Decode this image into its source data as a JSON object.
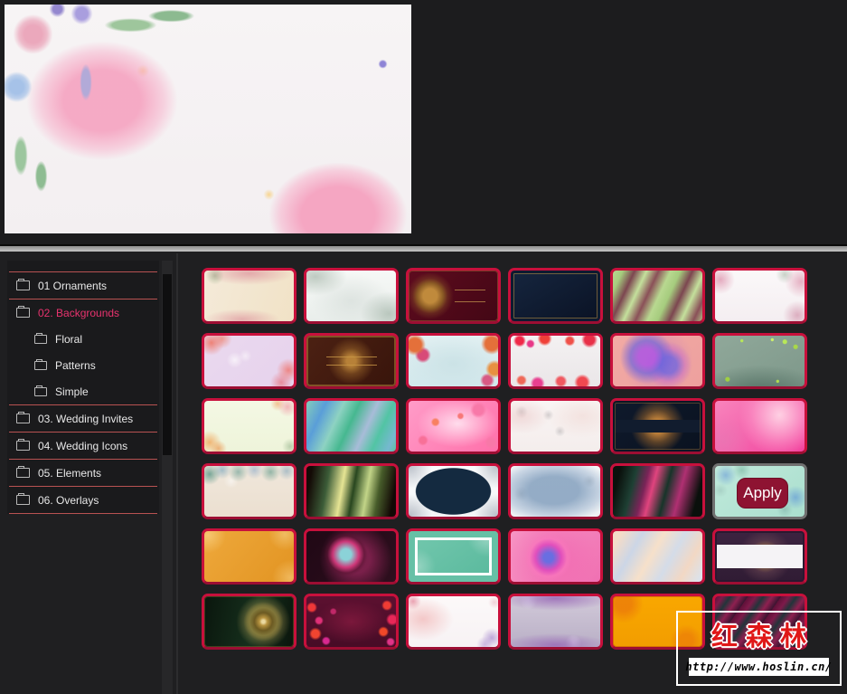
{
  "preview": {
    "name": "watercolor-floral-background",
    "style": "background: radial-gradient(circle 5px at 93% 26%, #8e84d6 60%, rgba(142,132,214,.5) 80%, transparent 100%), radial-gradient(circle 22px at 7% 13%, #eba8bc 45%, rgba(235,168,188,.75) 70%, transparent 100%), radial-gradient(circle 8px at 7% 13%, #c86a80 60%, transparent 100%), radial-gradient(circle 17px at 3% 36%, #a6c2e8 45%, rgba(166,194,232,.7) 75%, transparent 100%), radial-gradient(circle 5px at 3% 36%, #4a4a58 70%, transparent 100%), radial-gradient(circle 12px at 19% 4%, #a99ede 55%, transparent 100%), radial-gradient(circle 9px at 13% 2%, #9487cf 55%, transparent 100%), radial-gradient(ellipse 34px 9px at 31% 9%, #9ec69c 60%, transparent 85%), radial-gradient(ellipse 30px 8px at 41% 5%, #8cba90 60%, transparent 85%), radial-gradient(ellipse 9px 26px at 4% 66%, #9cc69e 60%, transparent 85%), radial-gradient(ellipse 8px 20px at 9% 75%, #8ebc92 60%, transparent 85%), radial-gradient(ellipse 8px 24px at 20% 34%, #b2aad8 60%, transparent 85%), radial-gradient(ellipse 95px 75px at 24% 42%, rgba(245,158,189,.85) 45%, rgba(247,176,202,.5) 72%, transparent 88%), radial-gradient(ellipse 85px 65px at 82% 92%, rgba(245,158,189,.9) 48%, rgba(247,176,202,.55) 75%, transparent 90%), radial-gradient(circle 7px at 34% 29%, rgba(249,206,120,.75), transparent 100%), radial-gradient(circle 6px at 65% 83%, rgba(249,206,120,.8), transparent 100%), linear-gradient(#f7f4f5,#f3eff1)"
  },
  "sidebar": {
    "items": [
      {
        "label": "01 Ornaments",
        "level": 0,
        "selected": false
      },
      {
        "label": "02. Backgrounds",
        "level": 0,
        "selected": true
      },
      {
        "label": "Floral",
        "level": 1,
        "selected": false
      },
      {
        "label": "Patterns",
        "level": 1,
        "selected": false
      },
      {
        "label": "Simple",
        "level": 1,
        "selected": false
      },
      {
        "label": "03. Wedding Invites",
        "level": 0,
        "selected": false
      },
      {
        "label": "04. Wedding Icons",
        "level": 0,
        "selected": false
      },
      {
        "label": "05. Elements",
        "level": 0,
        "selected": false
      },
      {
        "label": "06. Overlays",
        "level": 0,
        "selected": false
      }
    ],
    "selected_color": "#e8336e",
    "separator_color": "#b85252"
  },
  "apply_button": {
    "label": "Apply",
    "bg": "#8e1332",
    "text_color": "#ffffff"
  },
  "watermark": {
    "title": "红森林",
    "url": "http://www.hoslin.cn/",
    "title_color": "#e01818"
  },
  "colors": {
    "thumb_border": "#c8103c",
    "hovered_thumb_border": "#707070",
    "splitter": "#b5b5b5",
    "panel_bg": "#1a1a1c",
    "page_bg": "#1d1d1f"
  },
  "grid": {
    "columns": 6,
    "rows": 6,
    "thumbs": [
      {
        "name": "floral-cream-roses",
        "style": "background: radial-gradient(ellipse 70px 18px at 50% 6%, rgba(214,120,140,.55), transparent 70%), radial-gradient(ellipse 60px 16px at 42% 96%, rgba(214,120,140,.5), transparent 70%), radial-gradient(circle 10px at 12% 10%, rgba(120,150,110,.5), transparent 100%), linear-gradient(110deg,#f4ead9,#f1e2c6)"
      },
      {
        "name": "sage-leaves-white",
        "style": "background: radial-gradient(ellipse 50px 30px at 10% 12%, rgba(145,165,150,.55), transparent 70%), radial-gradient(ellipse 45px 35px at 92% 85%, rgba(135,158,142,.5), transparent 70%), radial-gradient(ellipse 60px 40px at 50% 60%, rgba(210,218,214,.6), transparent 75%), linear-gradient(#f6f8f6,#e9eeeb)"
      },
      {
        "name": "maroon-gold-mandala",
        "style": "background: linear-gradient(rgba(200,155,80,.7),rgba(200,155,80,.7)) 78% 38%/34px 1px no-repeat, linear-gradient(rgba(200,155,80,.7),rgba(200,155,80,.7)) 78% 62%/34px 1px no-repeat, radial-gradient(circle 26px at 24% 50%, #c08a3c 30%, #8a5a24 55%, rgba(140,90,40,.35) 75%, transparent 100%), linear-gradient(130deg,#5e0b1e,#430715); box-shadow: inset 0 0 0 1px rgba(200,150,70,.35)"
      },
      {
        "name": "navy-gold-frame",
        "style": "background: linear-gradient(150deg,#16263f,#0a1224); box-shadow: inset 0 0 0 3px #0e1a30, inset 0 0 0 4px rgba(190,150,70,.55)"
      },
      {
        "name": "green-maroon-streaks",
        "style": "background: repeating-linear-gradient(115deg, #b8d890 0px, #a6cc7e 10px, #7c4650 22px, #c4e09c 34px, #8a5058 46px, #b8d890 58px)"
      },
      {
        "name": "white-rose-corners",
        "style": "background: radial-gradient(circle 16px at 6% 18%, rgba(216,130,160,.65), transparent 100%), radial-gradient(circle 18px at 96% 22%, rgba(216,130,160,.6), transparent 100%), radial-gradient(circle 16px at 92% 88%, rgba(200,120,150,.55), transparent 100%), radial-gradient(circle 10px at 78% 8%, rgba(150,170,150,.5), transparent 100%), linear-gradient(#fbf8f9,#f4eef1)"
      },
      {
        "name": "lavender-rose-bokeh",
        "style": "background: radial-gradient(circle 14px at 8% 14%, rgba(238,120,105,.9), transparent 100%), radial-gradient(circle 11px at 20% 6%, rgba(238,130,110,.7), transparent 100%), radial-gradient(circle 13px at 94% 68%, rgba(238,120,115,.85), transparent 100%), radial-gradient(circle 12px at 86% 92%, rgba(230,110,120,.7), transparent 100%), radial-gradient(circle 9px at 34% 48%, rgba(255,255,255,.65), transparent 100%), radial-gradient(circle 7px at 46% 40%, rgba(255,255,255,.5), transparent 100%), linear-gradient(135deg,#ead9ef,#e6d2ec)"
      },
      {
        "name": "brown-gold-ornament",
        "style": "background: linear-gradient(rgba(200,150,70,.8),rgba(200,150,70,.8)) 50% 42%/56px 1px no-repeat, linear-gradient(rgba(200,150,70,.8),rgba(200,150,70,.8)) 50% 58%/56px 1px no-repeat, radial-gradient(circle 26px at 50% 50%, rgba(196,140,60,.9) 20%, rgba(150,98,40,.55) 55%, transparent 100%), linear-gradient(130deg,#4c2113,#38140b); box-shadow: inset 0 0 0 2px rgba(190,140,60,.5)"
      },
      {
        "name": "aqua-orange-floral",
        "style": "background: radial-gradient(circle 12px at 7% 18%, #e4703a 60%, transparent 100%), radial-gradient(circle 9px at 16% 38%, #d84a78 60%, transparent 100%), radial-gradient(circle 12px at 93% 16%, #e4703a 60%, transparent 100%), radial-gradient(circle 10px at 96% 66%, #e89040 60%, transparent 100%), radial-gradient(circle 8px at 88% 88%, #d85a84 60%, transparent 100%), radial-gradient(ellipse 70px 40px at 50% 55%, rgba(200,224,228,.8), transparent 80%), linear-gradient(#e2f0f2,#d2e8ec)"
      },
      {
        "name": "white-red-bokeh",
        "style": "background: radial-gradient(circle 7px at 10% 10%, #f02848 60%, transparent 100%), radial-gradient(circle 5px at 22% 16%, #e83888 60%, transparent 100%), radial-gradient(circle 8px at 38% 6%, #f04038 60%, transparent 100%), radial-gradient(circle 6px at 66% 10%, #f05048 60%, transparent 100%), radial-gradient(circle 9px at 88% 8%, #e83048 60%, transparent 100%), radial-gradient(circle 6px at 12% 88%, #f06858 60%, transparent 100%), radial-gradient(circle 8px at 30% 94%, #e84090 60%, transparent 100%), radial-gradient(circle 7px at 56% 90%, #f05860 60%, transparent 100%), radial-gradient(circle 9px at 80% 92%, #f04850 60%, transparent 100%), linear-gradient(#f4f1f2,#eae6e8)"
      },
      {
        "name": "pink-purple-swirl",
        "style": "background: radial-gradient(circle 30px at 38% 42%, rgba(178,90,224,.9) 30%, rgba(110,100,220,.7) 60%, transparent 100%), radial-gradient(circle 26px at 62% 58%, rgba(120,105,220,.85) 35%, rgba(200,110,200,.5) 70%, transparent 100%), radial-gradient(circle 40px at 50% 50%, rgba(160,90,210,.4), transparent 100%), linear-gradient(135deg,#f2aaa4,#eda09e)"
      },
      {
        "name": "sage-green-bokeh",
        "style": "background: radial-gradient(circle 3px at 78% 12%, #b8e858 70%, transparent 100%), radial-gradient(circle 2px at 64% 8%, #cdf06a 70%, transparent 100%), radial-gradient(circle 3px at 90% 22%, #a8d848 70%, transparent 100%), radial-gradient(circle 2px at 30% 10%, #b8e858 70%, transparent 100%), radial-gradient(circle 3px at 14% 86%, #a0d040 70%, transparent 100%), radial-gradient(circle 2px at 70% 90%, #b0dc50 70%, transparent 100%), radial-gradient(ellipse 90px 40px at 50% 115%, rgba(70,100,88,.8), transparent 80%), linear-gradient(150deg,#90a89a,#7e988a)"
      },
      {
        "name": "pale-green-peach-floral",
        "style": "background: radial-gradient(circle 13px at 6% 82%, rgba(240,165,90,.8), transparent 100%), radial-gradient(circle 9px at 16% 94%, rgba(235,150,80,.7), transparent 100%), radial-gradient(circle 11px at 93% 12%, rgba(240,160,170,.75), transparent 100%), radial-gradient(circle 8px at 82% 6%, rgba(240,170,110,.7), transparent 100%), radial-gradient(circle 9px at 96% 90%, rgba(150,180,140,.6), transparent 100%), linear-gradient(#f4f8e4,#eef4da)"
      },
      {
        "name": "teal-blue-marble",
        "style": "background: linear-gradient(115deg, #84ccba 0%, #5a9ed8 18%, #8ed2c2 34%, #46b890 48%, #a8bcd8 64%, #52c4a4 78%, #76b8d0 92%, #5ec0a0 100%)"
      },
      {
        "name": "pink-hearts",
        "style": "background: radial-gradient(circle 9px at 78% 18%, #f878a8 60%, transparent 100%), radial-gradient(circle 6px at 16% 78%, #f87098 60%, transparent 100%), radial-gradient(circle 5px at 30% 42%, #f88060 60%, transparent 100%), radial-gradient(circle 4px at 58% 30%, #f87878 60%, transparent 100%), radial-gradient(circle 7px at 92% 82%, #f878a8 60%, transparent 100%), radial-gradient(ellipse 60px 35px at 55% 45%, rgba(255,230,242,.9), transparent 75%), linear-gradient(135deg,#ff9cc8,#ff70aa)"
      },
      {
        "name": "sketch-tulips-watercolor",
        "style": "background: radial-gradient(ellipse 40px 25px at 12% 30%, rgba(235,200,200,.6), transparent 80%), radial-gradient(ellipse 50px 30px at 80% 30%, rgba(238,210,205,.5), transparent 80%), radial-gradient(circle 7px at 12% 22%, rgba(120,120,125,.35), transparent 100%), radial-gradient(circle 6px at 42% 28%, rgba(120,120,125,.3), transparent 100%), radial-gradient(circle 6px at 55% 60%, rgba(120,120,125,.3), transparent 100%), linear-gradient(#f9f5f4,#f4edec)"
      },
      {
        "name": "navy-split-gold-mandala",
        "style": "background: linear-gradient(#111c2e,#111c2e) 50% 50%/100% 14px no-repeat, radial-gradient(circle 30px at 50% 50%, rgba(210,140,60,.9) 25%, rgba(170,110,45,.5) 60%, transparent 100%), linear-gradient(140deg,#0f1a2c,#0a1220); box-shadow: inset 0 0 0 2px #0c1524, inset 0 0 0 3px rgba(180,130,60,.4)"
      },
      {
        "name": "magenta-pink-gradient",
        "style": "background: radial-gradient(circle 45px at 72% 28%, rgba(255,214,230,.95), rgba(252,150,200,.5) 70%, transparent 100%), radial-gradient(circle 30px at 10% 80%, rgba(230,120,180,.6), transparent 100%), linear-gradient(140deg,#f884bc,#f2439e)"
      },
      {
        "name": "succulent-cream",
        "style": "background: radial-gradient(circle 12px at 6% 16%, rgba(90,150,135,.8), transparent 100%), radial-gradient(circle 10px at 20% 8%, rgba(130,170,190,.7), transparent 100%), radial-gradient(circle 11px at 38% 12%, rgba(110,160,150,.65), transparent 100%), radial-gradient(circle 10px at 56% 8%, rgba(140,170,200,.6), transparent 100%), radial-gradient(circle 11px at 74% 12%, rgba(100,155,140,.65), transparent 100%), radial-gradient(circle 10px at 92% 10%, rgba(130,165,185,.6), transparent 100%), radial-gradient(circle 8px at 30% 30%, rgba(255,255,255,.5), transparent 100%), linear-gradient(#f0e7db,#ebdfd0)"
      },
      {
        "name": "black-gold-green-waves",
        "style": "background: linear-gradient(100deg, #140a06 6%, #3c5c38 24%, #e6e494 40%, #28461f 52%, #c2d488 66%, #475c2a 78%, #120805 94%)"
      },
      {
        "name": "white-navy-badge",
        "style": "background: radial-gradient(ellipse 42px 26px at 50% 50%, #142a40 98%, transparent 100%), radial-gradient(circle 24px at 2% 2%, rgba(130,140,155,.5), transparent 100%), radial-gradient(circle 24px at 98% 2%, rgba(130,140,155,.5), transparent 100%), radial-gradient(circle 24px at 2% 98%, rgba(130,140,155,.5), transparent 100%), radial-gradient(circle 24px at 98% 98%, rgba(130,140,155,.5), transparent 100%), linear-gradient(#fbfcfd,#f3f5f7)"
      },
      {
        "name": "blue-watercolor-sketch",
        "style": "background: radial-gradient(ellipse 70px 38px at 48% 48%, rgba(132,160,190,.85) 40%, rgba(150,175,205,.45) 75%, transparent 95%), radial-gradient(circle 8px at 12% 55%, rgba(110,115,120,.35), transparent 100%), radial-gradient(circle 7px at 88% 30%, rgba(110,115,120,.3), transparent 100%), linear-gradient(#f6f7f8,#eef1f3)"
      },
      {
        "name": "dark-magenta-green-waves",
        "style": "background: linear-gradient(105deg, #0a100c 8%, #1e4034 24%, #7a2458 36%, #e0447e 44%, #173429 58%, #b03072 72%, #0a100c 90%)"
      },
      {
        "name": "mint-blue-floral",
        "hovered": true,
        "style": "background: radial-gradient(circle 12px at 12% 18%, rgba(110,160,215,.65), transparent 100%), radial-gradient(circle 10px at 30% 8%, rgba(120,180,160,.6), transparent 100%), radial-gradient(circle 13px at 90% 62%, rgba(100,155,215,.7), transparent 100%), radial-gradient(circle 9px at 78% 86%, rgba(130,180,170,.6), transparent 100%), radial-gradient(circle 8px at 6% 48%, rgba(150,190,180,.5), transparent 100%), linear-gradient(140deg,#c0e9db,#aadfce)"
      },
      {
        "name": "gold-lace",
        "style": "background: radial-gradient(circle 20px at 4% 8%, rgba(255,230,170,.5), transparent 100%), radial-gradient(circle 20px at 96% 92%, rgba(255,225,160,.45), transparent 100%), radial-gradient(circle 18px at 90% 6%, rgba(255,235,180,.4), transparent 100%), linear-gradient(130deg,#eea83b,#e29422)"
      },
      {
        "name": "dark-pink-teal-swirl",
        "style": "background: radial-gradient(circle 24px at 44% 46%, rgba(140,220,224,.95) 25%, rgba(222,60,130,.85) 60%, rgba(90,20,50,.5) 85%, transparent 100%), radial-gradient(circle 40px at 55% 55%, rgba(200,50,120,.5) 40%, transparent 100%), linear-gradient(130deg,#200815,#2e0f1e)"
      },
      {
        "name": "teal-white-frame",
        "style": "background: radial-gradient(circle 22px at 88% 12%, rgba(255,255,255,.35), transparent 100%), radial-gradient(circle 20px at 10% 70%, rgba(255,255,255,.3), transparent 100%), linear-gradient(145deg,#74c8ae,#58b89c); box-shadow: inset 0 0 0 7px #66c0a6, inset 0 0 0 10px #ffffff"
      },
      {
        "name": "pink-blue-spiral",
        "style": "background: radial-gradient(circle 26px at 42% 52%, rgba(90,110,230,.9) 20%, rgba(220,70,190,.8) 55%, rgba(250,120,190,.6) 80%, transparent 100%), radial-gradient(circle 50px at 45% 50%, rgba(240,80,170,.5), transparent 100%), linear-gradient(130deg,#f796c4,#f070b2)"
      },
      {
        "name": "pastel-peach-blue-swirl",
        "style": "background: linear-gradient(120deg,#f4dcc8 8%, #ccd6e6 26%, #f6e0ca 44%, #d4dce8 62%, #f2d8c4 80%, #dce2ea 96%)"
      },
      {
        "name": "purple-mandala-white-band",
        "style": "background: linear-gradient(#f5f3f6,#f5f3f6) 50% 50%/100% 26px no-repeat, radial-gradient(circle 30px at 56% 50%, rgba(186,142,84,.7) 30%, rgba(120,80,90,.4) 60%, transparent 100%), linear-gradient(#3c2340,#301c34); box-shadow: inset 0 0 0 2px #2a1830"
      },
      {
        "name": "green-gold-mandala",
        "style": "background: radial-gradient(circle 22px at 66% 50%, #ead9a0 8%, #b89440 20%, #6c5a22 45%, rgba(190,160,70,.4) 70%, transparent 100%), radial-gradient(circle 30px at 66% 50%, rgba(220,190,100,.35) 60%, transparent 100%), linear-gradient(100deg,#0a160d,#16301d 55%, #0a140c); box-shadow: inset 0 0 0 1px rgba(180,150,60,.3)"
      },
      {
        "name": "maroon-petal-confetti",
        "style": "background: radial-gradient(circle 6px at 6% 22%, #f03838 60%, transparent 100%), radial-gradient(circle 5px at 14% 48%, #e03078 60%, transparent 100%), radial-gradient(circle 7px at 10% 74%, #f04430 60%, transparent 100%), radial-gradient(circle 5px at 22% 88%, #d82890 60%, transparent 100%), radial-gradient(circle 6px at 90% 18%, #f03c34 60%, transparent 100%), radial-gradient(circle 7px at 96% 46%, #e82858 60%, transparent 100%), radial-gradient(circle 6px at 86% 70%, #f04828 60%, transparent 100%), radial-gradient(circle 5px at 94% 90%, #e03488 60%, transparent 100%), radial-gradient(circle 4px at 30% 30%, #c02868 60%, transparent 100%), radial-gradient(ellipse 50px 30px at 50% 50%, rgba(150,30,70,.6), transparent 80%), linear-gradient(#5c1030,#470c26)"
      },
      {
        "name": "white-pink-lilac-floral",
        "style": "background: radial-gradient(ellipse 40px 28px at 16% 45%, rgba(240,175,175,.65), transparent 85%), radial-gradient(circle 11px at 93% 82%, rgba(165,135,205,.7), transparent 100%), radial-gradient(circle 9px at 85% 95%, rgba(175,145,210,.6), transparent 100%), radial-gradient(circle 9px at 5% 10%, rgba(220,90,120,.55), transparent 100%), radial-gradient(circle 7px at 96% 12%, rgba(230,170,185,.5), transparent 100%), linear-gradient(#fcf9f9,#f7f2f4)"
      },
      {
        "name": "lavender-roses-band",
        "style": "background: radial-gradient(ellipse 75px 16px at 50% 4%, rgba(152,104,182,.85), transparent 85%), radial-gradient(ellipse 70px 15px at 50% 96%, rgba(152,104,182,.8), transparent 85%), radial-gradient(circle 10px at 20% 8%, rgba(235,235,245,.8), transparent 100%), radial-gradient(circle 9px at 70% 92%, rgba(238,235,246,.75), transparent 100%), linear-gradient(#d2cad9,#b9afc6)"
      },
      {
        "name": "amber-lace",
        "style": "background: radial-gradient(circle 22px at 12% 14%, rgba(235,120,10,.75) 40%, transparent 100%), radial-gradient(circle 18px at 82% 88%, rgba(235,120,10,.65) 40%, transparent 100%), linear-gradient(#f9a700,#f29d00); box-shadow: inset 0 0 0 1px rgba(200,90,0,.6)"
      },
      {
        "name": "maroon-teal-waves",
        "style": "background: repeating-linear-gradient(125deg, #5e1138 0px, #7e1a4a 7px, #23343a 14px, #8e2050 22px, #3a1430 30px)"
      }
    ]
  }
}
